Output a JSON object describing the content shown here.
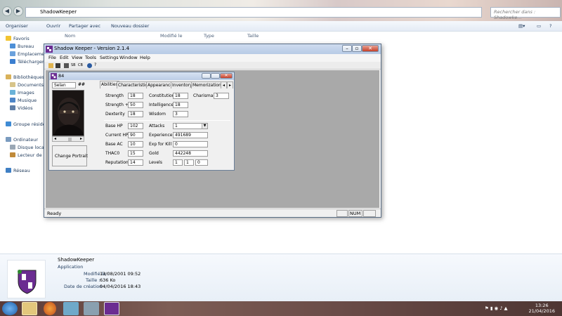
{
  "explorer": {
    "breadcrumb": "ShadowKeeper",
    "search_placeholder": "Rechercher dans : Shadowke...",
    "commands": {
      "organize": "Organiser",
      "open": "Ouvrir",
      "share": "Partager avec",
      "new_folder": "Nouveau dossier"
    },
    "columns": [
      "Nom",
      "Modifié le",
      "Type",
      "Taille"
    ],
    "sidebar": {
      "favorites": "Favoris",
      "desktop": "Bureau",
      "places": "Emplacement",
      "downloads": "Téléchargem",
      "libraries": "Bibliothèques",
      "documents": "Documents",
      "pictures": "Images",
      "music": "Musique",
      "videos": "Vidéos",
      "homegroup": "Groupe résiden",
      "computer": "Ordinateur",
      "local_disk": "Disque local (",
      "dvd_drive": "Lecteur de DV",
      "network": "Réseau"
    },
    "details": {
      "name": "ShadowKeeper",
      "type": "Application",
      "modified_label": "Modifié le :",
      "modified_value": "13/08/2001 09:52",
      "size_label": "Taille :",
      "size_value": "636 Ko",
      "created_label": "Date de création :",
      "created_value": "04/04/2016 18:43"
    }
  },
  "taskbar": {
    "time": "13:26",
    "date": "21/04/2016"
  },
  "app": {
    "title": "Shadow Keeper - Version 2.1.4",
    "menu": [
      "File",
      "Edit",
      "View",
      "Tools",
      "Settings",
      "Window",
      "Help"
    ],
    "toolbar_labels": [
      "SB",
      "CB"
    ],
    "status": {
      "ready": "Ready",
      "num": "NUM"
    },
    "child": {
      "title": "84",
      "name_value": "Selan",
      "name_button": "##",
      "change_portrait": "Change Portrait",
      "tabs": [
        "Abilities",
        "Characteristics",
        "Appearance",
        "Inventory",
        "Memorization"
      ],
      "abilities": {
        "strength_label": "Strength",
        "strength_value": "18",
        "strength_plus_label": "Strength +",
        "strength_plus_value": "50",
        "dexterity_label": "Dexterity",
        "dexterity_value": "18",
        "constitution_label": "Constitution",
        "constitution_value": "18",
        "intelligence_label": "Intelligence",
        "intelligence_value": "18",
        "wisdom_label": "Wisdom",
        "wisdom_value": "3",
        "charisma_label": "Charisma",
        "charisma_value": "3"
      },
      "stats": {
        "base_hp_label": "Base HP",
        "base_hp_value": "102",
        "current_hp_label": "Current HP",
        "current_hp_value": "90",
        "base_ac_label": "Base AC",
        "base_ac_value": "10",
        "thac0_label": "THAC0",
        "thac0_value": "15",
        "reputation_label": "Reputation",
        "reputation_value": "14",
        "attacks_label": "Attacks",
        "attacks_value": "1",
        "experience_label": "Experience",
        "experience_value": "491689",
        "exp_kill_label": "Exp for Kill",
        "exp_kill_value": "0",
        "gold_label": "Gold",
        "gold_value": "442248",
        "levels_label": "Levels",
        "level_1": "1",
        "level_2": "1",
        "level_3": "0"
      }
    }
  },
  "colors": {
    "client_bg": "#a9a9a9",
    "title_gradient": "#bccde6",
    "taskbar": "#6a4c48"
  }
}
